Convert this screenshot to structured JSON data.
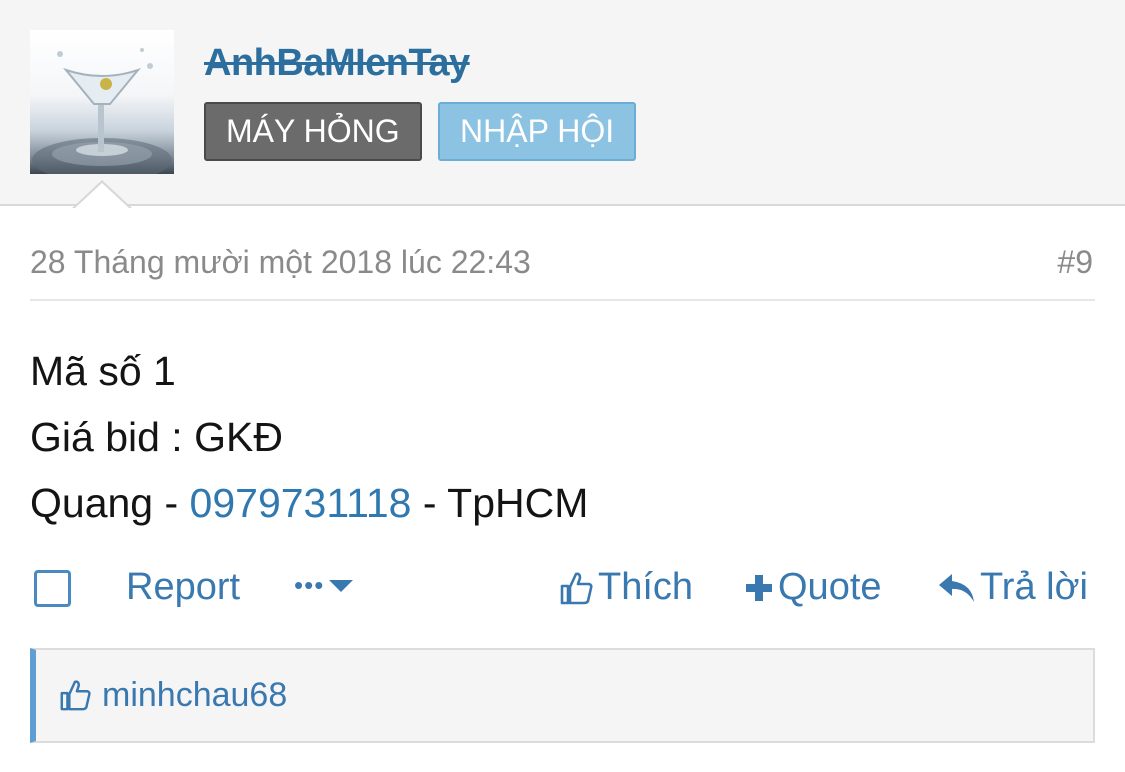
{
  "post": {
    "username": "AnhBaMIenTay",
    "badges": [
      "MÁY HỎNG",
      "NHẬP HỘI"
    ],
    "date": "28 Tháng mười một 2018 lúc 22:43",
    "post_number": "#9",
    "lines": {
      "line1": "Mã số 1",
      "line2": "Giá bid : GKĐ",
      "line3_prefix": "Quang - ",
      "line3_phone": "0979731118",
      "line3_suffix": " - TpHCM"
    }
  },
  "actions": {
    "report": "Report",
    "more": "•••",
    "like": "Thích",
    "quote": "Quote",
    "reply": "Trả lời"
  },
  "likes": {
    "user": "minhchau68"
  },
  "colors": {
    "link": "#3a78b0",
    "badge_gray": "#6b6b6b",
    "badge_blue": "#8dc3e2",
    "likes_accent": "#5f9ed3"
  },
  "icons": {
    "check": "checkbox",
    "more": "chevron-down-icon",
    "like": "thumbs-up-icon",
    "quote": "plus-icon",
    "reply": "reply-arrow-icon"
  }
}
